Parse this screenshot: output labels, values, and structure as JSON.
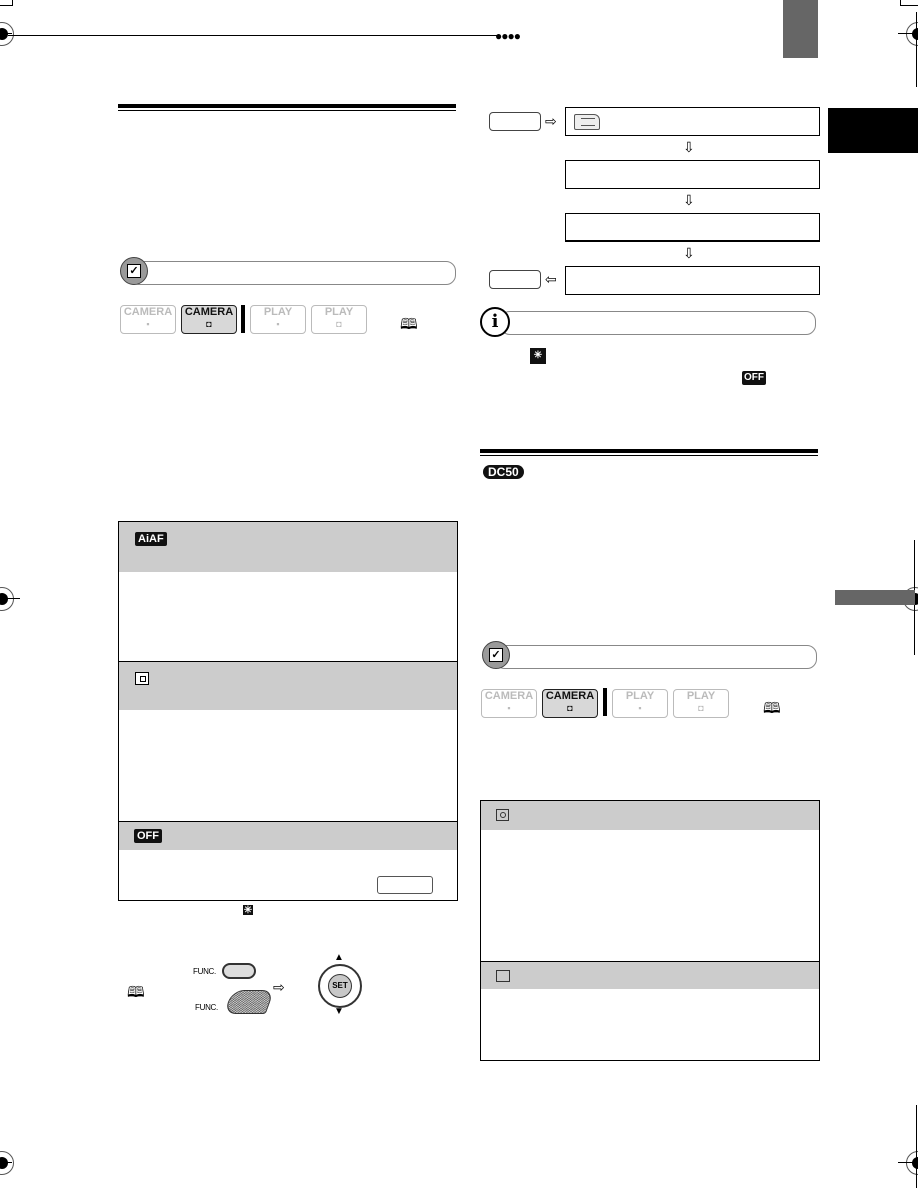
{
  "page": {
    "header_dots": "●●●●",
    "colors": {
      "tab_grey": "#666666",
      "tab_black": "#000000",
      "table_header": "#cccccc",
      "mode_active_bg": "#d8d8d8"
    }
  },
  "left_column": {
    "section_heading": "",
    "check_bar_label": "",
    "mode_buttons": [
      {
        "label": "CAMERA",
        "sub": "movie",
        "active": false
      },
      {
        "label": "CAMERA",
        "sub": "still",
        "active": true
      },
      {
        "label": "PLAY",
        "sub": "movie",
        "active": false
      },
      {
        "label": "PLAY",
        "sub": "still",
        "active": false
      }
    ],
    "book_ref": "🕮",
    "af_table": {
      "rows": [
        {
          "icon": "AiAF",
          "icon_type": "aiaf-badge",
          "description": ""
        },
        {
          "icon": "",
          "icon_type": "center-point-icon",
          "description": ""
        },
        {
          "icon": "OFF",
          "icon_type": "off-badge",
          "description": ""
        }
      ]
    },
    "func_labels": {
      "button": "FUNC.",
      "dial": "FUNC."
    },
    "joystick_label": "SET",
    "arrow_right": "⇨"
  },
  "right_column": {
    "flow": {
      "arrow_right": "⇨",
      "arrow_down": "⇩",
      "arrow_left": "⇦",
      "steps": [
        "",
        "",
        "",
        ""
      ]
    },
    "info_icon": "i",
    "note_off_badge": "OFF",
    "model_badge": "DC50",
    "check_bar_label": "",
    "mode_buttons": [
      {
        "label": "CAMERA",
        "sub": "movie",
        "active": false
      },
      {
        "label": "CAMERA",
        "sub": "still",
        "active": true
      },
      {
        "label": "PLAY",
        "sub": "movie",
        "active": false
      },
      {
        "label": "PLAY",
        "sub": "still",
        "active": false
      }
    ],
    "book_ref": "🕮",
    "metering_table": {
      "rows": [
        {
          "icon_type": "spot-metering-icon",
          "description": ""
        },
        {
          "icon_type": "frame-icon",
          "description": ""
        }
      ]
    }
  }
}
